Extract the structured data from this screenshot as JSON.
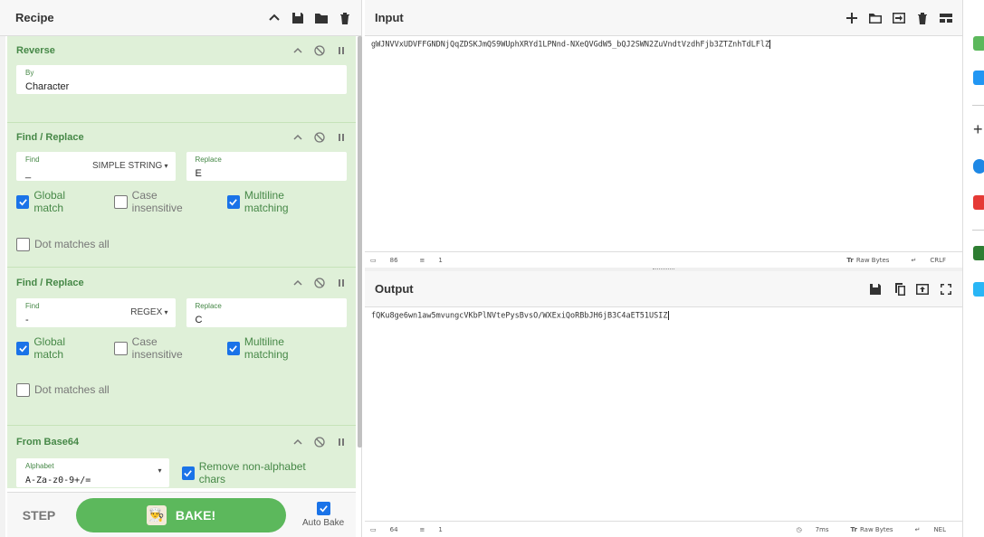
{
  "recipe": {
    "title": "Recipe",
    "operations": [
      {
        "title": "Reverse",
        "fields": [
          {
            "label": "By",
            "value": "Character"
          }
        ]
      },
      {
        "title": "Find / Replace",
        "find_label": "Find",
        "find_value": "_",
        "find_mode": "SIMPLE STRING",
        "replace_label": "Replace",
        "replace_value": "E",
        "checks": [
          {
            "label": "Global match",
            "checked": true
          },
          {
            "label": "Case insensitive",
            "checked": false
          },
          {
            "label": "Multiline matching",
            "checked": true
          },
          {
            "label": "Dot matches all",
            "checked": false
          }
        ]
      },
      {
        "title": "Find / Replace",
        "find_label": "Find",
        "find_value": "-",
        "find_mode": "REGEX",
        "replace_label": "Replace",
        "replace_value": "C",
        "checks": [
          {
            "label": "Global match",
            "checked": true
          },
          {
            "label": "Case insensitive",
            "checked": false
          },
          {
            "label": "Multiline matching",
            "checked": true
          },
          {
            "label": "Dot matches all",
            "checked": false
          }
        ]
      },
      {
        "title": "From Base64",
        "alphabet_label": "Alphabet",
        "alphabet_value": "A-Za-z0-9+/=",
        "remove_label": "Remove non-alphabet chars",
        "remove_checked": true
      }
    ],
    "step_label": "STEP",
    "bake_label": "BAKE!",
    "autobake_label": "Auto Bake"
  },
  "input": {
    "title": "Input",
    "text": "gWJNVVxUDVFFGNDNjQqZDSKJmQS9WUphXRYd1LPNnd-NXeQVGdW5_bQJ2SWN2ZuVndtVzdhFjb3ZTZnhTdLFlZ",
    "length": "86",
    "lines": "1",
    "enc": "Raw Bytes",
    "eol": "CRLF"
  },
  "output": {
    "title": "Output",
    "text": "fQKu8ge6wn1aw5mvungcVKbPlNVtePysBvsO/WXExiQoRBbJH6jB3C4aET51USIZ",
    "length": "64",
    "lines": "1",
    "time": "7ms",
    "enc": "Raw Bytes",
    "eol": "NEL"
  },
  "colors": {
    "op_bg": "#dff0d8",
    "op_text": "#468847",
    "bake": "#5cb85c",
    "check": "#1a73e8"
  }
}
